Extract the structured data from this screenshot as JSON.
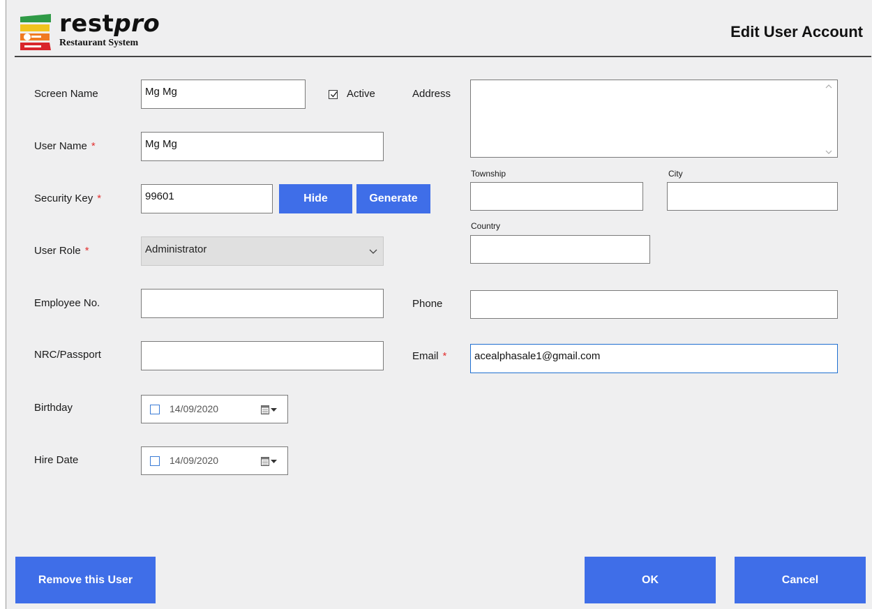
{
  "header": {
    "brand_main": "rest",
    "brand_accent": "pro",
    "brand_sub": "Restaurant System",
    "title": "Edit User Account"
  },
  "form": {
    "screen_name": {
      "label": "Screen Name",
      "value": "Mg Mg"
    },
    "active": {
      "label": "Active",
      "checked": true
    },
    "user_name": {
      "label": "User Name",
      "value": "Mg Mg"
    },
    "security_key": {
      "label": "Security Key",
      "value": "99601"
    },
    "hide_button": "Hide",
    "generate_button": "Generate",
    "user_role": {
      "label": "User Role",
      "value": "Administrator"
    },
    "employee_no": {
      "label": "Employee No.",
      "value": ""
    },
    "nrc_passport": {
      "label": "NRC/Passport",
      "value": ""
    },
    "birthday": {
      "label": "Birthday",
      "value": "14/09/2020"
    },
    "hire_date": {
      "label": "Hire Date",
      "value": "14/09/2020"
    },
    "address": {
      "label": "Address",
      "value": ""
    },
    "township": {
      "label": "Township",
      "value": ""
    },
    "city": {
      "label": "City",
      "value": ""
    },
    "country": {
      "label": "Country",
      "value": ""
    },
    "phone": {
      "label": "Phone",
      "value": ""
    },
    "email": {
      "label": "Email",
      "value": "acealphasale1@gmail.com"
    },
    "required_mark": "*"
  },
  "footer": {
    "remove_button": "Remove this User",
    "ok_button": "OK",
    "cancel_button": "Cancel"
  },
  "colors": {
    "button": "#3f6ee8",
    "required": "#e23030",
    "focus_border": "#1e6fd0",
    "background": "#efeff0"
  }
}
